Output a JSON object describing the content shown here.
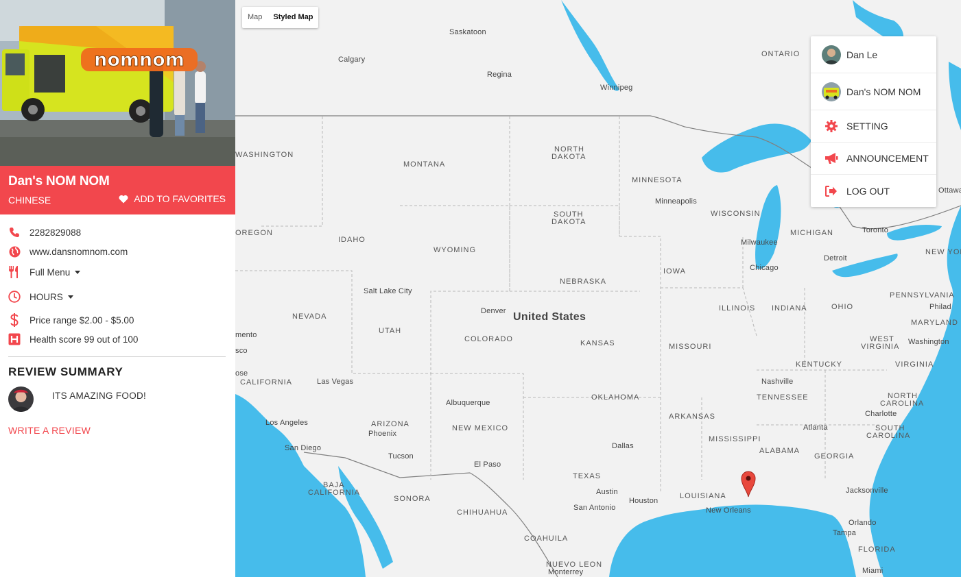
{
  "truck": {
    "name": "Dan's NOM NOM",
    "cuisine": "CHINESE",
    "favorite_label": "ADD TO FAVORITES",
    "phone": "2282829088",
    "website": "www.dansnomnom.com",
    "menu_label": "Full Menu",
    "hours_label": "HOURS",
    "price_range": "Price range $2.00 - $5.00",
    "health_score": "Health score 99 out of 100",
    "banner_logo_text": "nomnom"
  },
  "review": {
    "title": "REVIEW SUMMARY",
    "text": "ITS AMAZING FOOD!",
    "write_label": "WRITE A REVIEW"
  },
  "map": {
    "type_options": [
      "Map",
      "Styled Map"
    ],
    "selected_type": "Styled Map",
    "country_label": "United States",
    "state_labels": {
      "washington": "WASHINGTON",
      "montana": "MONTANA",
      "north_dakota_1": "NORTH",
      "north_dakota_2": "DAKOTA",
      "minnesota": "MINNESOTA",
      "oregon": "OREGON",
      "idaho": "IDAHO",
      "south_dakota_1": "SOUTH",
      "south_dakota_2": "DAKOTA",
      "wisconsin": "WISCONSIN",
      "michigan": "MICHIGAN",
      "wyoming": "WYOMING",
      "iowa": "IOWA",
      "nebraska": "NEBRASKA",
      "nevada": "NEVADA",
      "utah": "UTAH",
      "colorado": "COLORADO",
      "illinois": "ILLINOIS",
      "indiana": "INDIANA",
      "ohio": "OHIO",
      "pennsylvania": "PENNSYLVANIA",
      "kansas": "KANSAS",
      "missouri": "MISSOURI",
      "california": "CALIFORNIA",
      "kentucky": "KENTUCKY",
      "west_virginia_1": "WEST",
      "west_virginia_2": "VIRGINIA",
      "virginia": "VIRGINIA",
      "maryland": "MARYLAND",
      "new_york": "NEW YOR",
      "oklahoma": "OKLAHOMA",
      "tennessee": "TENNESSEE",
      "north_carolina_1": "NORTH",
      "north_carolina_2": "CAROLINA",
      "arizona": "ARIZONA",
      "new_mexico": "NEW MEXICO",
      "arkansas": "ARKANSAS",
      "mississippi": "MISSISSIPPI",
      "south_carolina_1": "SOUTH",
      "south_carolina_2": "CAROLINA",
      "alabama": "ALABAMA",
      "georgia": "GEORGIA",
      "texas": "TEXAS",
      "louisiana": "LOUISIANA",
      "florida": "FLORIDA",
      "ontario": "ONTARIO",
      "baja_1": "BAJA",
      "baja_2": "CALIFORNIA",
      "sonora": "SONORA",
      "chihuahua": "CHIHUAHUA",
      "coahuila": "COAHUILA",
      "nuevo_leon": "NUEVO LEON"
    },
    "city_labels": {
      "saskatoon": "Saskatoon",
      "calgary": "Calgary",
      "regina": "Regina",
      "winnipeg": "Winnipeg",
      "minneapolis": "Minneapolis",
      "milwaukee": "Milwaukee",
      "chicago": "Chicago",
      "detroit": "Detroit",
      "toronto": "Toronto",
      "ottawa": "Ottawa",
      "salt_lake_city": "Salt Lake City",
      "denver": "Denver",
      "philad": "Philad",
      "washington_dc": "Washington",
      "sacramento": "mento",
      "san_francisco": "sco",
      "san_jose": "ose",
      "las_vegas": "Las Vegas",
      "nashville": "Nashville",
      "charlotte": "Charlotte",
      "los_angeles": "Los Angeles",
      "albuquerque": "Albuquerque",
      "phoenix": "Phoenix",
      "atlanta": "Atlanta",
      "san_diego": "San Diego",
      "tucson": "Tucson",
      "el_paso": "El Paso",
      "dallas": "Dallas",
      "austin": "Austin",
      "houston": "Houston",
      "san_antonio": "San Antonio",
      "new_orleans": "New Orleans",
      "jacksonville": "Jacksonville",
      "orlando": "Orlando",
      "tampa": "Tampa",
      "monterrey": "Monterrey",
      "miami": "Miami"
    }
  },
  "user_menu": {
    "user_name": "Dan Le",
    "truck_name": "Dan's NOM NOM",
    "setting": "SETTING",
    "announcement": "ANNOUNCEMENT",
    "logout": "LOG OUT"
  },
  "colors": {
    "accent": "#f2474d",
    "water": "#46bceb",
    "land": "#f2f2f2"
  }
}
